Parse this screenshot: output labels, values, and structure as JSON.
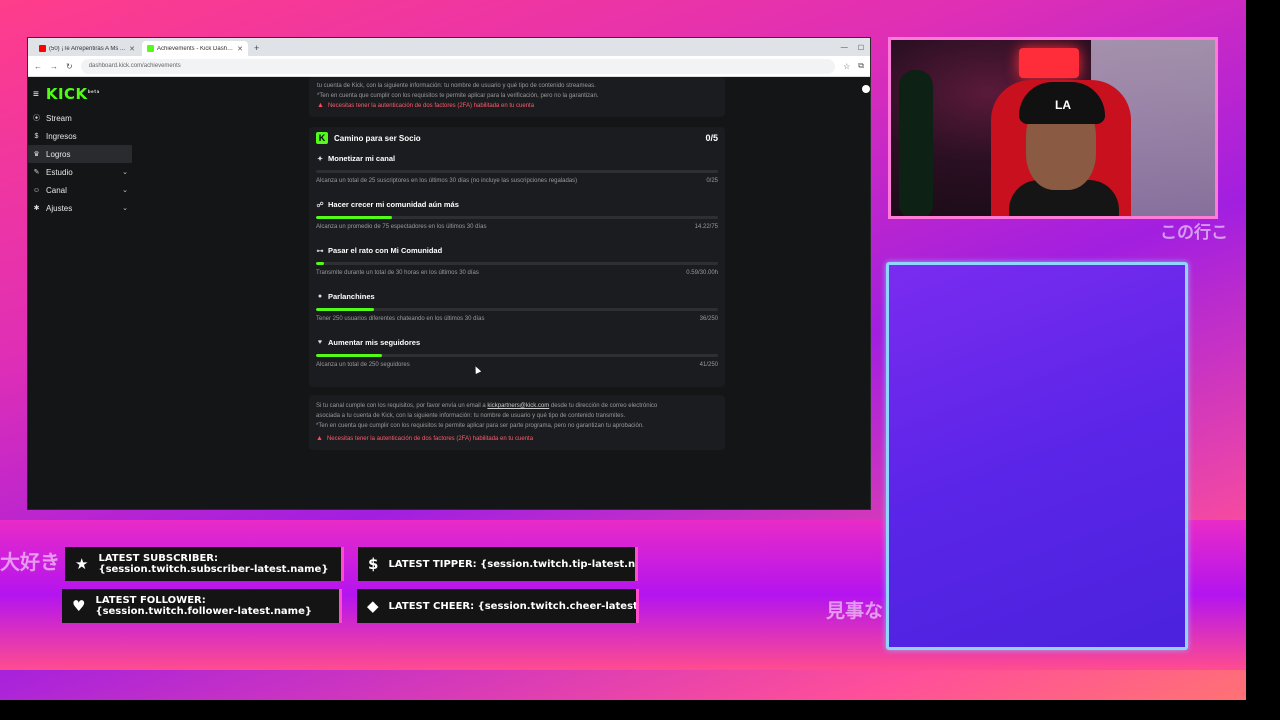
{
  "browser": {
    "tabs": [
      {
        "title": "(50) ¡Te Arrepentirás A Ms ...",
        "favicon_color": "#ff0000"
      },
      {
        "title": "Achievements - Kick Dashboard",
        "favicon_color": "#53fc18"
      }
    ],
    "url": "dashboard.kick.com/achievements"
  },
  "kick": {
    "logo": "KICK",
    "nav": [
      {
        "label": "Stream",
        "icon": "broadcast-icon",
        "active": false,
        "chevron": false
      },
      {
        "label": "Ingresos",
        "icon": "money-icon",
        "active": false,
        "chevron": false
      },
      {
        "label": "Logros",
        "icon": "trophy-icon",
        "active": true,
        "chevron": false
      },
      {
        "label": "Estudio",
        "icon": "pencil-icon",
        "active": false,
        "chevron": true
      },
      {
        "label": "Canal",
        "icon": "user-icon",
        "active": false,
        "chevron": true
      },
      {
        "label": "Ajustes",
        "icon": "gear-icon",
        "active": false,
        "chevron": true
      }
    ],
    "top_card": {
      "line1": "tu cuenta de Kick, con la siguiente información: tu nombre de usuario y qué tipo de contenido streameas.",
      "line2": "*Ten en cuenta que cumplir con los requisitos te permite aplicar para la verificación, pero no la garantizan.",
      "warning": "Necesitas tener la autenticación de dos factores (2FA) habilitada en tu cuenta"
    },
    "partner_card": {
      "title": "Camino para ser Socio",
      "count": "0/5",
      "requirements": [
        {
          "title": "Monetizar mi canal",
          "desc": "Alcanza un total de 25 suscriptores en los últimos 30 días (no incluye las suscripciones regaladas)",
          "progress": "0/25",
          "percent": 0
        },
        {
          "title": "Hacer crecer mi comunidad aún más",
          "desc": "Alcanza un promedio de 75 espectadores en los últimos 30 días",
          "progress": "14.22/75",
          "percent": 19
        },
        {
          "title": "Pasar el rato con Mi Comunidad",
          "desc": "Transmite durante un total de 30 horas en los últimos 30 días",
          "progress": "0.59/30.00h",
          "percent": 2
        },
        {
          "title": "Parlanchines",
          "desc": "Tener 250 usuarios diferentes chateando en los últimos 30 días",
          "progress": "36/250",
          "percent": 14.4
        },
        {
          "title": "Aumentar mis seguidores",
          "desc": "Alcanza un total de 250 seguidores",
          "progress": "41/250",
          "percent": 16.4
        }
      ]
    },
    "bottom_card": {
      "line1a": "Si tu canal cumple con los requisitos, por favor envía un email a ",
      "email": "kickpartners@kick.com",
      "line1b": " desde tu dirección de correo electrónico",
      "line2": "asociada a tu cuenta de Kick, con la siguiente información: tu nombre de usuario y qué tipo de contenido transmites.",
      "line3": "*Ten en cuenta que cumplir con los requisitos te permite aplicar para ser parte programa, pero no garantizan tu aprobación.",
      "warning": "Necesitas tener la autenticación de dos factores (2FA) habilitada en tu cuenta"
    }
  },
  "overlay": {
    "jp_left": "大好き",
    "jp_top_right": "この行こ",
    "jp_bottom_right": "見事な",
    "tickers": {
      "subscriber": "LATEST SUBSCRIBER: {session.twitch.subscriber-latest.name}",
      "tipper": "LATEST TIPPER: {session.twitch.tip-latest.name} - {session.twitch.tip-latest.amount}",
      "follower": "LATEST FOLLOWER: {session.twitch.follower-latest.name}",
      "cheer": "LATEST CHEER: {session.twitch.cheer-latest.name} - {session.twitch.cheer-latest.amount}"
    },
    "colors": {
      "kick_green": "#53fc18",
      "warning_red": "#ff5a6a",
      "ticker_border": "#ff4ecb"
    }
  }
}
